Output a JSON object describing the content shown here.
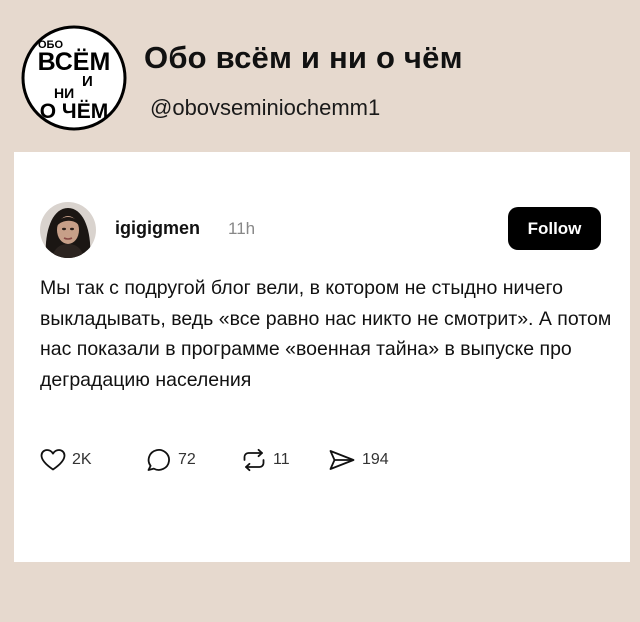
{
  "channel": {
    "logo_lines": [
      "ОБО",
      "ВСЁМ",
      "И",
      "НИ",
      "О ЧЁМ"
    ],
    "title": "Обо всём и ни о чём",
    "handle": "@obovseminiochemm1"
  },
  "post": {
    "username": "igigigmen",
    "time": "11h",
    "follow_label": "Follow",
    "text": "Мы так с подругой блог вели, в котором не стыдно ничего выкладывать, ведь «все равно нас никто не смотрит». А потом нас показали в программе «военная тайна» в выпуске про деградацию населения",
    "actions": {
      "likes": {
        "icon": "heart-icon",
        "count": "2K"
      },
      "comments": {
        "icon": "comment-icon",
        "count": "72"
      },
      "reposts": {
        "icon": "repost-icon",
        "count": "11"
      },
      "shares": {
        "icon": "send-icon",
        "count": "194"
      }
    }
  }
}
